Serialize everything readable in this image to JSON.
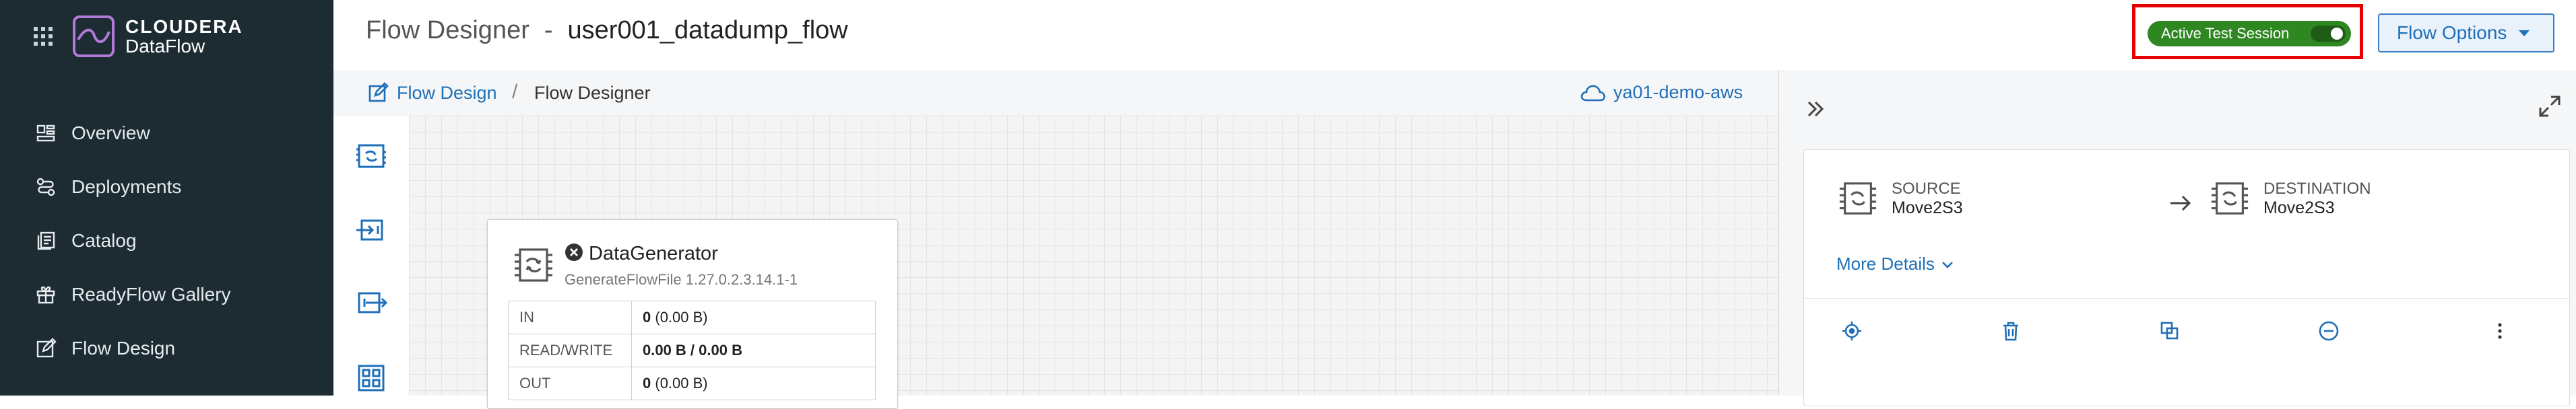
{
  "brand": {
    "name": "CLOUDERA",
    "product": "DataFlow"
  },
  "sidebar": {
    "items": [
      {
        "label": "Overview",
        "icon": "overview-icon"
      },
      {
        "label": "Deployments",
        "icon": "deployments-icon"
      },
      {
        "label": "Catalog",
        "icon": "catalog-icon"
      },
      {
        "label": "ReadyFlow Gallery",
        "icon": "gift-icon"
      },
      {
        "label": "Flow Design",
        "icon": "flow-design-icon"
      }
    ]
  },
  "header": {
    "title": "Flow Designer",
    "separator": "-",
    "flow_name": "user001_datadump_flow",
    "session_label": "Active Test Session",
    "flow_options_label": "Flow Options"
  },
  "breadcrumb": {
    "link": "Flow Design",
    "separator": "/",
    "current": "Flow Designer",
    "environment": "ya01-demo-aws"
  },
  "processor": {
    "name": "DataGenerator",
    "type": "GenerateFlowFile 1.27.0.2.3.14.1-1",
    "stats": [
      {
        "key": "IN",
        "value_bold": "0",
        "value_rest": " (0.00 B)"
      },
      {
        "key": "READ/WRITE",
        "value_bold": "0.00 B / 0.00 B",
        "value_rest": ""
      },
      {
        "key": "OUT",
        "value_bold": "0",
        "value_rest": " (0.00 B)"
      }
    ]
  },
  "connection_panel": {
    "source_label": "SOURCE",
    "source_value": "Move2S3",
    "destination_label": "DESTINATION",
    "destination_value": "Move2S3",
    "more_details": "More Details"
  },
  "colors": {
    "sidebar_bg": "#1d2b33",
    "accent": "#1f6fb8",
    "session_green": "#2f8722",
    "highlight_red": "#e60000"
  }
}
